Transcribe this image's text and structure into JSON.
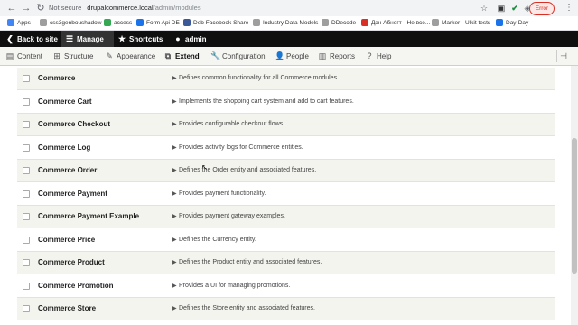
{
  "browser": {
    "back_icon": "arrow-left-icon",
    "forward_icon": "arrow-right-icon",
    "reload_icon": "reload-icon",
    "security_label": "Not secure",
    "url_host": "drupalcommerce.local",
    "url_path": "/admin/modules",
    "error_label": "Error"
  },
  "bookmarks": [
    {
      "label": "Apps",
      "color": "#4285f4"
    },
    {
      "label": "css3genboushadow",
      "color": "#9e9e9e"
    },
    {
      "label": "access",
      "color": "#34a853"
    },
    {
      "label": "Form Api DE",
      "color": "#1a73e8"
    },
    {
      "label": "Deb Facebook Share",
      "color": "#3b5998"
    },
    {
      "label": "Industry Data Models",
      "color": "#9e9e9e"
    },
    {
      "label": "DDecode",
      "color": "#9e9e9e"
    },
    {
      "label": "Дэн Абнегт - Не все...",
      "color": "#d93025"
    },
    {
      "label": "Marker - Ulkit tests",
      "color": "#9e9e9e"
    },
    {
      "label": "Day-Day",
      "color": "#1a73e8"
    }
  ],
  "toolbar": {
    "back_to_site": "Back to site",
    "manage": "Manage",
    "shortcuts": "Shortcuts",
    "user": "admin"
  },
  "tray": [
    {
      "label": "Content",
      "icon": "content-icon",
      "active": false
    },
    {
      "label": "Structure",
      "icon": "structure-icon",
      "active": false
    },
    {
      "label": "Appearance",
      "icon": "appearance-icon",
      "active": false
    },
    {
      "label": "Extend",
      "icon": "extend-icon",
      "active": true
    },
    {
      "label": "Configuration",
      "icon": "configuration-icon",
      "active": false
    },
    {
      "label": "People",
      "icon": "people-icon",
      "active": false
    },
    {
      "label": "Reports",
      "icon": "reports-icon",
      "active": false
    },
    {
      "label": "Help",
      "icon": "help-icon",
      "active": false
    }
  ],
  "modules": [
    {
      "name": "Commerce",
      "description": "Defines common functionality for all Commerce modules."
    },
    {
      "name": "Commerce Cart",
      "description": "Implements the shopping cart system and add to cart features."
    },
    {
      "name": "Commerce Checkout",
      "description": "Provides configurable checkout flows."
    },
    {
      "name": "Commerce Log",
      "description": "Provides activity logs for Commerce entities."
    },
    {
      "name": "Commerce Order",
      "description": "Defines the Order entity and associated features."
    },
    {
      "name": "Commerce Payment",
      "description": "Provides payment functionality."
    },
    {
      "name": "Commerce Payment Example",
      "description": "Provides payment gateway examples."
    },
    {
      "name": "Commerce Price",
      "description": "Defines the Currency entity."
    },
    {
      "name": "Commerce Product",
      "description": "Defines the Product entity and associated features."
    },
    {
      "name": "Commerce Promotion",
      "description": "Provides a UI for managing promotions."
    },
    {
      "name": "Commerce Store",
      "description": "Defines the Store entity and associated features."
    }
  ]
}
